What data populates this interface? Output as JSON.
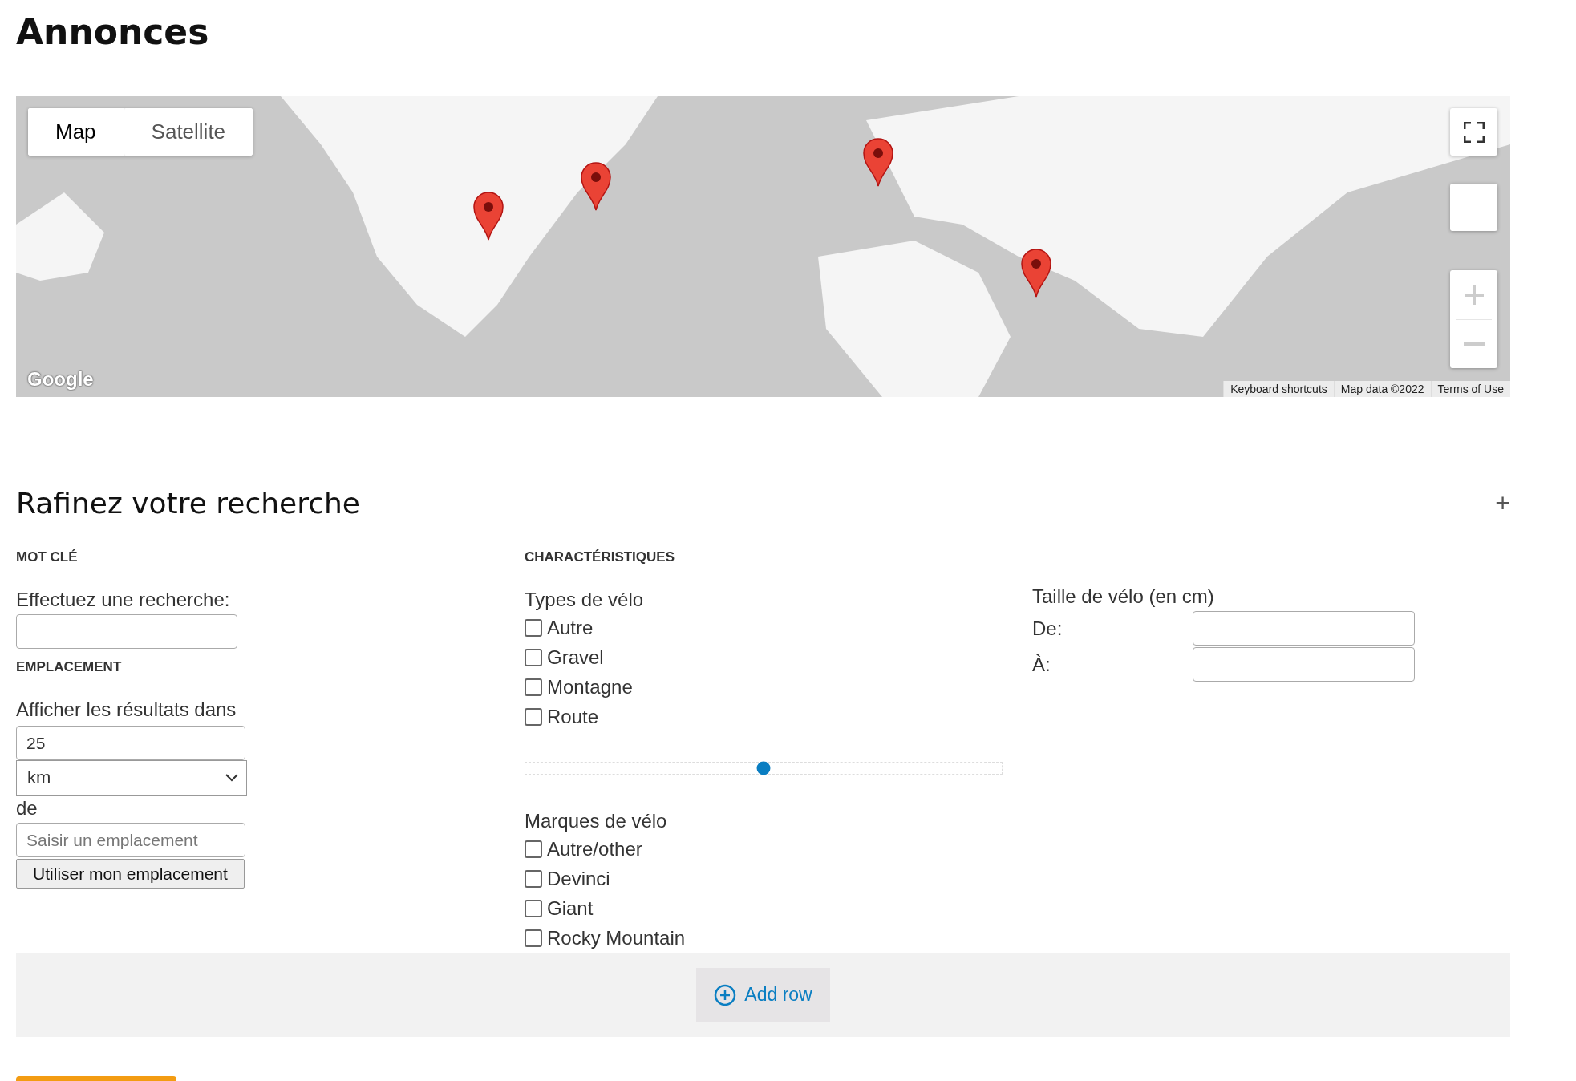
{
  "page_title": "Annonces",
  "map": {
    "map_types": [
      {
        "label": "Map",
        "selected": true
      },
      {
        "label": "Satellite",
        "selected": false
      }
    ],
    "logo": "Google",
    "attribution": [
      "Keyboard shortcuts",
      "Map data ©2022",
      "Terms of Use"
    ]
  },
  "filters": {
    "title": "Rafinez votre recherche",
    "expand_symbol": "+",
    "keyword": {
      "heading": "MOT CLÉ",
      "label": "Effectuez une recherche:"
    },
    "location": {
      "heading": "EMPLACEMENT",
      "label": "Afficher les résultats dans",
      "distance": "25",
      "unit": "km",
      "from_label": "de",
      "placeholder": "Saisir un emplacement",
      "button": "Utiliser mon emplacement"
    },
    "features": {
      "heading": "CHARACTÉRISTIQUES",
      "types_label": "Types de vélo",
      "types": [
        {
          "label": "Autre",
          "checked": false
        },
        {
          "label": "Gravel",
          "checked": false
        },
        {
          "label": "Montagne",
          "checked": false
        },
        {
          "label": "Route",
          "checked": false
        }
      ],
      "slider": {
        "level": 0.5
      },
      "brands_label": "Marques de vélo",
      "brands": [
        {
          "label": "Autre/other",
          "checked": false
        },
        {
          "label": "Devinci",
          "checked": false
        },
        {
          "label": "Giant",
          "checked": false
        },
        {
          "label": "Rocky Mountain",
          "checked": false
        }
      ]
    },
    "size": {
      "label": "Taille de vélo (en cm)",
      "from": "De:",
      "to": "À:"
    }
  },
  "add_row": "Add row"
}
